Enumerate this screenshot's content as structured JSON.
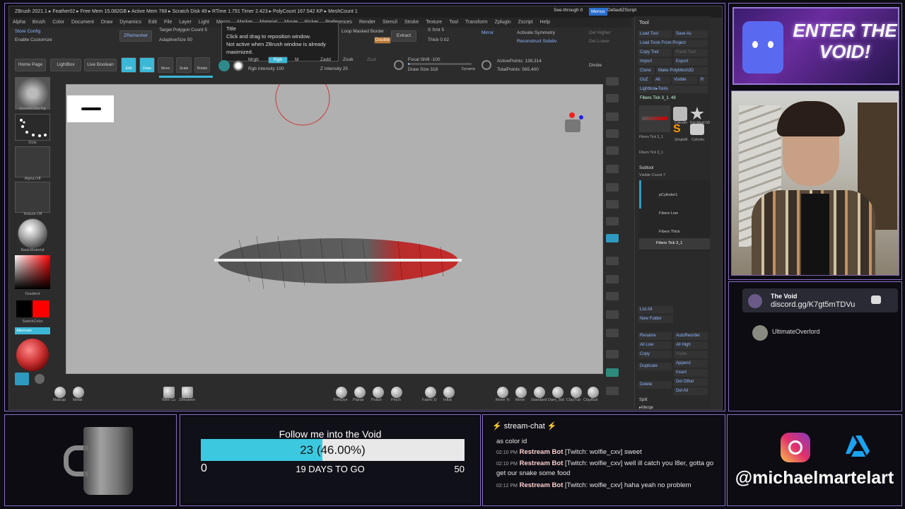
{
  "zbrush": {
    "title": "ZBrush 2021.1 ▸ Feather02 ▸ Free Mem 15.082GB ▸ Active Mem 768 ▸ Scratch Disk 49 ▸ RTime 1.791 Timer 2.423 ▸ PolyCount 167.542 KP ▸ MeshCount 1",
    "menus": [
      "Alpha",
      "Brush",
      "Color",
      "Document",
      "Draw",
      "Dynamics",
      "Edit",
      "File",
      "Layer",
      "Light",
      "Macro",
      "Marker",
      "Material",
      "Movie",
      "Picker",
      "Preferences",
      "Render",
      "Stencil",
      "Stroke",
      "Texture",
      "Tool",
      "Transform",
      "Zplugin",
      "Zscript",
      "Help"
    ],
    "top_right": {
      "see_through": "See-through 0",
      "menus": "Menus",
      "default_script": "DefaultZScript"
    },
    "buttons": {
      "store_config": "Store Config",
      "enable_customize": "Enable Customize",
      "zremesher": "ZRemesher",
      "target_polygon_count": "Target Polygon Count 5",
      "adaptive_size": "AdaptiveSize 50",
      "home_page": "Home Page",
      "lightbox": "LightBox",
      "live_boolean": "Live Boolean",
      "edit": "Edit",
      "draw": "Draw",
      "move": "Move",
      "scale": "Scale",
      "rotate": "Rotate",
      "mrgb": "Mrgb",
      "rgb": "Rgb",
      "m": "M",
      "zadd": "Zadd",
      "zsub": "Zsub",
      "zcut": "Zcut",
      "rgb_intensity": "Rgb Intensity 100",
      "z_intensity": "Z Intensity 25",
      "loop_masked_border": "Loop Masked Border",
      "extract": "Extract",
      "double": "Double",
      "s_smt": "S Smt 5",
      "thick": "Thick 0.02",
      "focal_shift": "Focal Shift -100",
      "draw_size": "Draw Size 318",
      "dynamic": "Dynamic",
      "active_points": "ActivePoints: 138,314",
      "total_points": "TotalPoints: 565,400",
      "mirror": "Mirror",
      "activate_symmetry": "Activate Symmetry",
      "reconstruct_subdiv": "Reconstruct Subdiv",
      "del_higher": "Del Higher",
      "del_lower": "Del Lower",
      "divide": "Divide"
    },
    "tooltip": {
      "title": "Title",
      "line1": "Click and drag to reposition window.",
      "line2": "Not active when ZBrush window is already maximized."
    },
    "left_shelf": {
      "brush": "GroomColorTip",
      "stroke": "Dots",
      "alpha": "Alpha Off",
      "texture": "Texture Off",
      "material": "BasicMaterial",
      "gradient": "Gradient",
      "switch_color": "SwitchColor",
      "alternate": "Alternate"
    },
    "bottom_shelf": [
      "Matcap",
      "Metal",
      "IMM Cu",
      "ZModeler",
      "TrimDyn",
      "Planar",
      "Polish",
      "Pinch",
      "Fabric D",
      "Inflat",
      "Move Tc",
      "Move",
      "Standard",
      "Dam_Std",
      "ClayTub",
      "ClayBuil"
    ],
    "tool_panel": {
      "header": "Tool",
      "load_tool": "Load Tool",
      "save_as": "Save As",
      "load_from_project": "Load Tools From Project",
      "copy_tool": "Copy Tool",
      "paste_tool": "Paste Tool",
      "import": "Import",
      "export": "Export",
      "clone": "Clone",
      "make_polymesh": "Make PolyMesh3D",
      "goz": "GoZ",
      "all": "All",
      "visible": "Visible",
      "r": "R",
      "lightbox_tools": "Lightbox▸Tools",
      "current_tool": "Fibers Tick 3_1. 49",
      "tool_names": [
        "Fibers Tick 3_1",
        "Cylinder",
        "PolyMesh3D",
        "SimpleB",
        "Cylinder",
        "Fibers Tick 3_1"
      ],
      "subtool_header": "Subtool",
      "visible_count": "Visible Count 7",
      "subtools": [
        "pCylinder1",
        "Fibers Low",
        "Fibers Thick",
        "Fibers Tick 3_1"
      ],
      "list_all": "List All",
      "new_folder": "New Folder",
      "rename": "Rename",
      "auto_reorder": "AutoReorder",
      "all_low": "All Low",
      "all_high": "All High",
      "copy": "Copy",
      "paste": "Paste",
      "duplicate": "Duplicate",
      "append": "Append",
      "insert": "Insert",
      "delete": "Delete",
      "del_other": "Del Other",
      "del_all": "Del All",
      "split": "Split",
      "merge": "▸Merge"
    }
  },
  "overlay": {
    "discord_banner": "ENTER THE VOID!",
    "discord_name": "The Void",
    "discord_link": "discord.gg/K7gt5mTDVu",
    "user_name": "UltimateOverlord",
    "goal": {
      "title": "Follow me into the Void",
      "current": 23,
      "label": "23 (46.00%)",
      "percent": 46,
      "min": "0",
      "max": "50",
      "days": "19 DAYS TO GO",
      "fill_color": "#3cc9e0"
    },
    "chat": {
      "header": "stream-chat",
      "messages": [
        {
          "time": "",
          "who": "",
          "text": "as color id"
        },
        {
          "time": "02:10 PM",
          "who": "Restream Bot",
          "text": "[Twitch: wolfie_cxv] sweet"
        },
        {
          "time": "02:10 PM",
          "who": "Restream Bot",
          "text": "[Twitch: wolfie_cxv] well ill catch you l8er, gotta go get our snake some food"
        },
        {
          "time": "02:12 PM",
          "who": "Restream Bot",
          "text": "[Twitch: wolfie_cxv] haha yeah no problem"
        }
      ]
    },
    "handle": "@michaelmartelart"
  }
}
